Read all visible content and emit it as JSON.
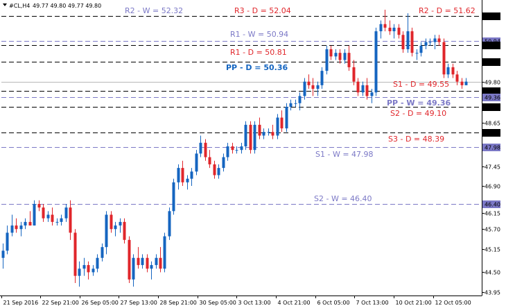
{
  "chart_data": {
    "type": "candlestick",
    "symbol_label": "#CL,H4",
    "ohlc_header": "49.77 49.80 49.77 49.80",
    "ylim": [
      43.95,
      51.78
    ],
    "y_ticks": [
      "51.62",
      "50.94",
      "50.81",
      "50.36",
      "49.80",
      "49.55",
      "49.36",
      "49.10",
      "48.65",
      "48.39",
      "47.98",
      "47.45",
      "46.90",
      "46.40",
      "46.15",
      "45.70",
      "45.15",
      "44.50",
      "43.95"
    ],
    "x_ticks": [
      "21 Sep 2016",
      "22 Sep 21:00",
      "26 Sep 05:00",
      "27 Sep 13:00",
      "28 Sep 21:00",
      "30 Sep 05:00",
      "3 Oct 13:00",
      "4 Oct 21:00",
      "6 Oct 05:00",
      "7 Oct 13:00",
      "10 Oct 21:00",
      "12 Oct 05:00"
    ],
    "colors": {
      "up": "#1565c0",
      "down": "#e0262b",
      "daily": "#e0262b",
      "weekly": "#7b78c6",
      "line": "#000000",
      "current": "#b8b8b8"
    },
    "current_price": {
      "value": 49.8,
      "label": "49.80"
    },
    "pivot_levels": [
      {
        "label": "R2 - W = 52.32",
        "value": null,
        "tag": "",
        "kind": "weekly",
        "bold": false
      },
      {
        "label": "R3 - D = 52.04",
        "value": null,
        "tag": "",
        "kind": "daily",
        "bold": false
      },
      {
        "label": "R2 - D = 51.62",
        "value": 51.62,
        "tag": "51.62",
        "kind": "daily",
        "bold": false
      },
      {
        "label": "R1 - W = 50.94",
        "value": 50.94,
        "tag": "50.94",
        "kind": "weekly",
        "bold": false
      },
      {
        "label": "R1 - D = 50.81",
        "value": 50.81,
        "tag": "50.81",
        "kind": "daily",
        "bold": false
      },
      {
        "label": "PP - D = 50.36",
        "value": 50.36,
        "tag": "50.36",
        "kind": "pp-daily",
        "bold": true
      },
      {
        "label": "S1 - D = 49.55",
        "value": 49.55,
        "tag": "49.55",
        "kind": "daily",
        "bold": false
      },
      {
        "label": "PP - W = 49.36",
        "value": 49.36,
        "tag": "49.36",
        "kind": "pp-weekly",
        "bold": true
      },
      {
        "label": "S2 - D = 49.10",
        "value": 49.1,
        "tag": "49.10",
        "kind": "daily",
        "bold": false
      },
      {
        "label": "S3 - D = 48.39",
        "value": 48.39,
        "tag": "48.39",
        "kind": "daily",
        "bold": false
      },
      {
        "label": "S1 - W = 47.98",
        "value": 47.98,
        "tag": "47.98",
        "kind": "weekly",
        "bold": false
      },
      {
        "label": "S2 - W = 46.40",
        "value": 46.4,
        "tag": "46.40",
        "kind": "weekly",
        "bold": false
      }
    ],
    "candles": [
      [
        44.9,
        45.3,
        44.6,
        45.1
      ],
      [
        45.1,
        45.8,
        45.0,
        45.6
      ],
      [
        45.6,
        46.1,
        45.5,
        45.8
      ],
      [
        45.8,
        46.0,
        45.6,
        45.7
      ],
      [
        45.7,
        45.9,
        45.5,
        45.8
      ],
      [
        45.8,
        46.0,
        45.7,
        45.9
      ],
      [
        45.9,
        46.2,
        45.8,
        45.8
      ],
      [
        45.8,
        46.5,
        45.8,
        46.4
      ],
      [
        46.4,
        46.5,
        46.2,
        46.3
      ],
      [
        46.3,
        46.4,
        45.9,
        46.0
      ],
      [
        46.0,
        46.2,
        45.9,
        46.1
      ],
      [
        46.1,
        46.3,
        45.8,
        45.9
      ],
      [
        45.9,
        46.0,
        45.8,
        45.9
      ],
      [
        45.9,
        46.1,
        45.8,
        46.0
      ],
      [
        46.0,
        46.4,
        45.9,
        46.3
      ],
      [
        46.3,
        46.5,
        45.4,
        45.6
      ],
      [
        45.6,
        45.7,
        44.2,
        44.4
      ],
      [
        44.4,
        44.8,
        44.1,
        44.6
      ],
      [
        44.6,
        44.9,
        44.4,
        44.7
      ],
      [
        44.7,
        44.8,
        44.3,
        44.5
      ],
      [
        44.5,
        44.7,
        44.4,
        44.6
      ],
      [
        44.6,
        45.0,
        44.5,
        44.9
      ],
      [
        44.9,
        45.3,
        44.8,
        45.2
      ],
      [
        45.2,
        46.2,
        45.0,
        46.1
      ],
      [
        46.1,
        46.2,
        45.6,
        45.7
      ],
      [
        45.7,
        45.9,
        45.5,
        45.8
      ],
      [
        45.8,
        46.0,
        45.6,
        45.9
      ],
      [
        45.9,
        46.0,
        45.3,
        45.4
      ],
      [
        45.4,
        45.5,
        44.2,
        44.3
      ],
      [
        44.3,
        45.0,
        44.1,
        44.9
      ],
      [
        44.9,
        45.2,
        44.6,
        44.7
      ],
      [
        44.7,
        45.0,
        44.6,
        44.9
      ],
      [
        44.9,
        45.0,
        44.5,
        44.6
      ],
      [
        44.6,
        44.8,
        44.3,
        44.7
      ],
      [
        44.7,
        45.0,
        44.6,
        44.9
      ],
      [
        44.9,
        45.2,
        44.5,
        44.6
      ],
      [
        44.6,
        45.6,
        44.5,
        45.5
      ],
      [
        45.5,
        46.3,
        45.4,
        46.2
      ],
      [
        46.2,
        47.1,
        46.1,
        47.0
      ],
      [
        47.0,
        47.5,
        46.8,
        47.4
      ],
      [
        47.4,
        47.6,
        46.9,
        47.0
      ],
      [
        47.0,
        47.2,
        46.8,
        47.1
      ],
      [
        47.1,
        47.4,
        46.9,
        47.3
      ],
      [
        47.3,
        47.9,
        47.2,
        47.8
      ],
      [
        47.8,
        48.3,
        47.7,
        48.1
      ],
      [
        48.1,
        48.2,
        47.6,
        47.7
      ],
      [
        47.7,
        47.9,
        47.4,
        47.5
      ],
      [
        47.5,
        47.6,
        47.1,
        47.2
      ],
      [
        47.2,
        47.5,
        47.1,
        47.4
      ],
      [
        47.4,
        47.8,
        47.3,
        47.7
      ],
      [
        47.7,
        48.1,
        47.6,
        48.0
      ],
      [
        48.0,
        48.1,
        47.8,
        47.9
      ],
      [
        47.9,
        48.0,
        47.8,
        47.9
      ],
      [
        47.9,
        48.1,
        47.8,
        48.0
      ],
      [
        48.0,
        48.7,
        47.9,
        48.6
      ],
      [
        48.6,
        48.7,
        47.8,
        47.9
      ],
      [
        47.9,
        48.7,
        47.8,
        48.6
      ],
      [
        48.6,
        48.8,
        48.2,
        48.3
      ],
      [
        48.3,
        48.5,
        48.2,
        48.4
      ],
      [
        48.4,
        48.5,
        48.3,
        48.4
      ],
      [
        48.4,
        48.6,
        48.2,
        48.3
      ],
      [
        48.3,
        48.9,
        48.2,
        48.8
      ],
      [
        48.8,
        49.0,
        48.4,
        48.5
      ],
      [
        48.5,
        49.2,
        48.4,
        49.1
      ],
      [
        49.1,
        49.3,
        49.0,
        49.2
      ],
      [
        49.2,
        49.3,
        49.1,
        49.2
      ],
      [
        49.2,
        49.5,
        49.0,
        49.4
      ],
      [
        49.4,
        49.9,
        49.3,
        49.8
      ],
      [
        49.8,
        50.0,
        49.6,
        49.7
      ],
      [
        49.7,
        49.9,
        49.4,
        49.6
      ],
      [
        49.6,
        49.8,
        49.4,
        49.7
      ],
      [
        49.7,
        50.2,
        49.6,
        50.1
      ],
      [
        50.1,
        50.8,
        50.0,
        50.7
      ],
      [
        50.7,
        50.8,
        50.4,
        50.5
      ],
      [
        50.5,
        50.7,
        50.4,
        50.6
      ],
      [
        50.6,
        50.7,
        50.3,
        50.4
      ],
      [
        50.4,
        50.7,
        50.3,
        50.6
      ],
      [
        50.6,
        50.8,
        50.1,
        50.2
      ],
      [
        50.2,
        50.4,
        49.7,
        49.8
      ],
      [
        49.8,
        49.9,
        49.4,
        49.5
      ],
      [
        49.5,
        49.8,
        49.4,
        49.7
      ],
      [
        49.7,
        49.9,
        49.3,
        49.4
      ],
      [
        49.4,
        49.6,
        49.2,
        49.5
      ],
      [
        49.5,
        51.3,
        49.4,
        51.2
      ],
      [
        51.2,
        51.5,
        51.0,
        51.4
      ],
      [
        51.4,
        51.8,
        51.2,
        51.3
      ],
      [
        51.3,
        51.5,
        51.1,
        51.2
      ],
      [
        51.2,
        51.4,
        51.0,
        51.3
      ],
      [
        51.3,
        51.4,
        51.0,
        51.1
      ],
      [
        51.1,
        51.2,
        50.6,
        50.7
      ],
      [
        50.7,
        51.7,
        50.6,
        51.2
      ],
      [
        51.2,
        51.3,
        50.5,
        50.6
      ],
      [
        50.6,
        50.7,
        50.4,
        50.6
      ],
      [
        50.6,
        50.9,
        50.5,
        50.8
      ],
      [
        50.8,
        51.0,
        50.7,
        50.9
      ],
      [
        50.9,
        51.0,
        50.8,
        50.9
      ],
      [
        50.9,
        51.1,
        50.7,
        51.0
      ],
      [
        51.0,
        51.1,
        50.8,
        50.9
      ],
      [
        50.9,
        51.0,
        49.9,
        50.0
      ],
      [
        50.0,
        50.3,
        49.9,
        50.2
      ],
      [
        50.2,
        50.3,
        49.9,
        50.0
      ],
      [
        50.0,
        50.1,
        49.7,
        49.8
      ],
      [
        49.8,
        49.9,
        49.6,
        49.7
      ],
      [
        49.7,
        49.9,
        49.7,
        49.8
      ]
    ]
  }
}
